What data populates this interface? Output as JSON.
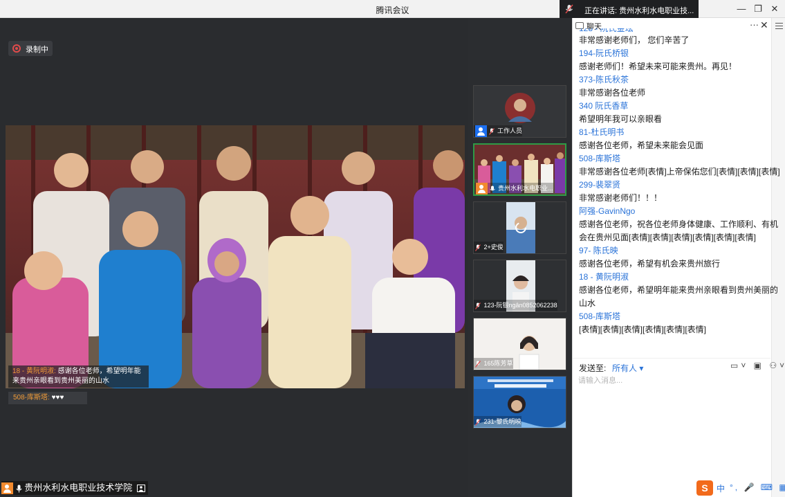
{
  "window": {
    "title": "腾讯会议",
    "speaking_banner": "正在讲话: 贵州水利水电职业技...",
    "min_glyph": "—",
    "restore_glyph": "❐",
    "close_glyph": "✕"
  },
  "recording": {
    "label": "录制中"
  },
  "main_video": {
    "subtitle": {
      "sender": "18 - 黄阮明淑:",
      "text": "感谢各位老师，希望明年能来贵州亲眼看到贵州美丽的山水"
    },
    "danmaku": {
      "sender": "508-库斯塔:",
      "text": "♥♥♥"
    },
    "presenter_name": "贵州水利水电职业技术学院"
  },
  "thumbnails": [
    {
      "label": "工作人员",
      "icon": "user-icon"
    },
    {
      "label": "贵州水利水电职业...",
      "icon": "user-icon"
    },
    {
      "label": "2+史俊",
      "icon": "mic-muted-icon"
    },
    {
      "label": "123-阮银ngân0852062238",
      "icon": "mic-muted-icon"
    },
    {
      "label": "165陈芳草",
      "icon": "mic-muted-icon"
    },
    {
      "label": "231-黎氏明映",
      "icon": "mic-muted-icon"
    }
  ],
  "chat": {
    "title": "聊天",
    "more_glyph": "···",
    "close_glyph": "✕",
    "top_partial_name": "128 - 阮氏金玹",
    "messages": [
      {
        "name": "",
        "text": "非常感谢老师们，  您们辛苦了"
      },
      {
        "name": "194-阮氏桥银",
        "text": "感谢老师们！希望未来可能来贵州。再见！"
      },
      {
        "name": "373-陈氏秋茶",
        "text": " 非常感谢各位老师"
      },
      {
        "name": "340 阮氏香草",
        "text": "希望明年我可以亲眼看"
      },
      {
        "name": "81-杜氏明书",
        "text": "感谢各位老师，希望未来能会见面"
      },
      {
        "name": "508-库斯塔",
        "text": "非常感谢各位老师[表情]上帝保佑您们[表情][表情][表情]"
      },
      {
        "name": "299-裴翠贤",
        "text": "非常感谢老师们！！！"
      },
      {
        "name": "阿强-GavinNgo",
        "text": "感谢各位老师，祝各位老师身体健康、工作顺利、有机会在贵州见面[表情][表情][表情][表情][表情][表情]"
      },
      {
        "name": "97- 陈氏映",
        "text": "感谢各位老师，希望有机会来贵州旅行"
      },
      {
        "name": "18 - 黄阮明淑",
        "text": "感谢各位老师，希望明年能来贵州亲眼看到贵州美丽的山水"
      },
      {
        "name": "508-库斯塔",
        "text": "[表情][表情][表情][表情][表情][表情]"
      }
    ],
    "send_label": "发送至:",
    "send_target": "所有人 ▾",
    "tools": "▭˅ ▣ ⚇˅",
    "input_placeholder": "请输入消息..."
  },
  "ime": {
    "logo": "S",
    "mode": "中",
    "rest": "°, 🎤 ⌨ ▦"
  }
}
